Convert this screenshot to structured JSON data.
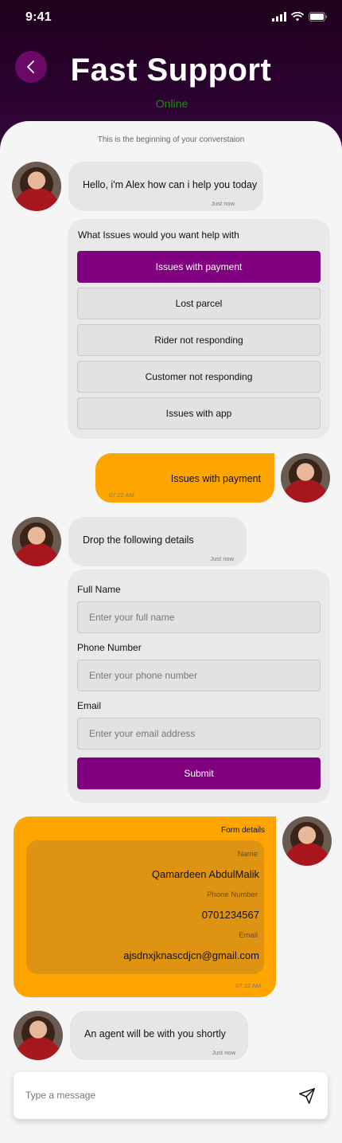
{
  "status_bar": {
    "time": "9:41"
  },
  "header": {
    "title": "Fast Support",
    "status": "Online"
  },
  "conversation": {
    "begin_note": "This is the beginning of your converstaion",
    "greeting": {
      "text": "Hello, i'm Alex how can i help you today",
      "time": "Just now"
    },
    "issues_card": {
      "question": "What Issues would you want help with",
      "options": [
        "Issues with payment",
        "Lost parcel",
        "Rider not responding",
        "Customer not responding",
        "Issues with app"
      ],
      "selected_index": 0
    },
    "user_reply": {
      "text": "Issues with payment",
      "time": "07:22 AM"
    },
    "details_prompt": {
      "text": "Drop the following details",
      "time": "Just now"
    },
    "form": {
      "full_name_label": "Full Name",
      "full_name_placeholder": "Enter your full name",
      "phone_label": "Phone Number",
      "phone_placeholder": "Enter your phone number",
      "email_label": "Email",
      "email_placeholder": "Enter your email address",
      "submit_label": "Submit"
    },
    "form_details": {
      "title": "Form details",
      "name_label": "Name",
      "name_value": "Qamardeen AbdulMalik",
      "phone_label": "Phone Number",
      "phone_value": "0701234567",
      "email_label": "Email",
      "email_value": "ajsdnxjknascdjcn@gmail.com",
      "time": "07:22 AM"
    },
    "agent_message": {
      "text": "An agent will be with you shortly",
      "time": "Just now"
    }
  },
  "composer": {
    "placeholder": "Type a message"
  },
  "colors": {
    "accent": "#800080",
    "sent_bubble": "#ffa500",
    "online": "#1f8a16"
  }
}
